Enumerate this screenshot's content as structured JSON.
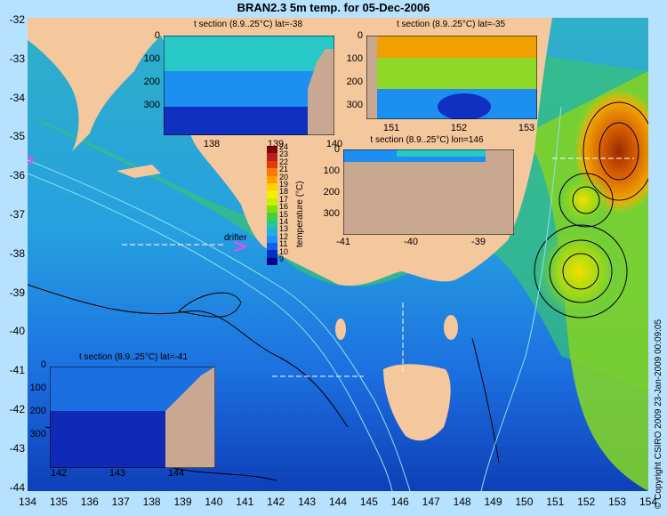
{
  "title": "BRAN2.3 5m temp. for 05-Dec-2006",
  "axes": {
    "x_ticks": [
      "134",
      "135",
      "136",
      "137",
      "138",
      "139",
      "140",
      "141",
      "142",
      "143",
      "144",
      "145",
      "146",
      "147",
      "148",
      "149",
      "150",
      "151",
      "152",
      "153",
      "154"
    ],
    "y_ticks": [
      "-32",
      "-33",
      "-34",
      "-35",
      "-36",
      "-37",
      "-38",
      "-39",
      "-40",
      "-41",
      "-42",
      "-43",
      "-44"
    ]
  },
  "colorbar": {
    "label": "temperature (°C)",
    "ticks": [
      "24",
      "23",
      "22",
      "21",
      "20",
      "19",
      "18",
      "17",
      "16",
      "15",
      "14",
      "13",
      "12",
      "11",
      "10",
      "9"
    ],
    "colors": [
      "#8b0000",
      "#b22222",
      "#e03a00",
      "#ff7800",
      "#ffa000",
      "#ffd000",
      "#f0f000",
      "#c8f000",
      "#80e000",
      "#40d040",
      "#20c8a0",
      "#20b0e0",
      "#2090ff",
      "#1060f0",
      "#0030c0",
      "#00008b"
    ]
  },
  "drifter_label": "drifter",
  "copyright": "© Copyright CSIRO 2009   23-Jan-2009 00:09:05",
  "insets": [
    {
      "title": "t section (8.9..25°C) lat=-38",
      "yticks": [
        "0",
        "100",
        "200",
        "300"
      ],
      "xticks": [
        "138",
        "139",
        "140"
      ]
    },
    {
      "title": "t section (8.9..25°C) lat=-35",
      "yticks": [
        "0",
        "100",
        "200",
        "300"
      ],
      "xticks": [
        "151",
        "152",
        "153"
      ]
    },
    {
      "title": "t section (8.9..25°C) lon=146",
      "yticks": [
        "0",
        "100",
        "200",
        "300"
      ],
      "xticks": [
        "-41",
        "-40",
        "-39"
      ]
    },
    {
      "title": "t section (8.9..25°C) lat=-41",
      "yticks": [
        "0",
        "100",
        "200",
        "300"
      ],
      "xticks": [
        "142",
        "143",
        "144"
      ]
    }
  ],
  "colors": {
    "land": "#f5c79c",
    "background": "#b7e2ff",
    "sea_deep": "#1a5ad8",
    "sea_mid": "#2fa0e8",
    "sea_warm": "#3fcf6f",
    "seabed": "#c8a890"
  }
}
